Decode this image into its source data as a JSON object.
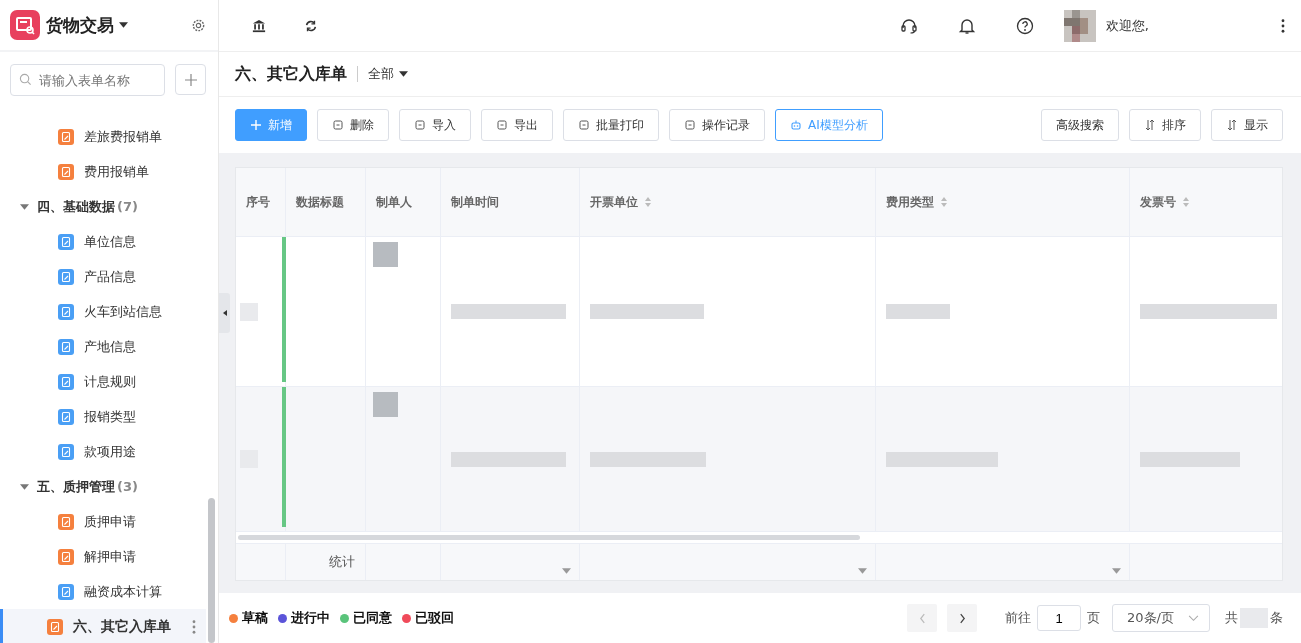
{
  "sidebar": {
    "app_title": "货物交易",
    "search": {
      "placeholder": "请输入表单名称"
    },
    "tree": [
      {
        "kind": "item",
        "label": "差旅费报销单",
        "color": "#f5803e",
        "selected": false
      },
      {
        "kind": "item",
        "label": "费用报销单",
        "color": "#f5803e",
        "selected": false
      },
      {
        "kind": "group",
        "label": "四、基础数据",
        "count": "(7)",
        "expanded": true,
        "children": [
          {
            "kind": "item",
            "label": "单位信息",
            "color": "#4a9ff5",
            "selected": false
          },
          {
            "kind": "item",
            "label": "产品信息",
            "color": "#4a9ff5",
            "selected": false
          },
          {
            "kind": "item",
            "label": "火车到站信息",
            "color": "#4a9ff5",
            "selected": false
          },
          {
            "kind": "item",
            "label": "产地信息",
            "color": "#4a9ff5",
            "selected": false
          },
          {
            "kind": "item",
            "label": "计息规则",
            "color": "#4a9ff5",
            "selected": false
          },
          {
            "kind": "item",
            "label": "报销类型",
            "color": "#4a9ff5",
            "selected": false
          },
          {
            "kind": "item",
            "label": "款项用途",
            "color": "#4a9ff5",
            "selected": false
          }
        ]
      },
      {
        "kind": "group",
        "label": "五、质押管理",
        "count": "(3)",
        "expanded": true,
        "children": [
          {
            "kind": "item",
            "label": "质押申请",
            "color": "#f5803e",
            "selected": false
          },
          {
            "kind": "item",
            "label": "解押申请",
            "color": "#f5803e",
            "selected": false
          },
          {
            "kind": "item",
            "label": "融资成本计算",
            "color": "#4a9ff5",
            "selected": false
          }
        ]
      },
      {
        "kind": "item",
        "label": "六、其它入库单",
        "color": "#f5803e",
        "selected": true
      }
    ]
  },
  "header": {
    "greeting": "欢迎您,"
  },
  "page": {
    "title": "六、其它入库单",
    "filter": "全部"
  },
  "toolbar": {
    "left": [
      {
        "label": "新增",
        "kind": "primary"
      },
      {
        "label": "删除",
        "kind": "plain"
      },
      {
        "label": "导入",
        "kind": "plain"
      },
      {
        "label": "导出",
        "kind": "plain"
      },
      {
        "label": "批量打印",
        "kind": "plain"
      },
      {
        "label": "操作记录",
        "kind": "plain"
      },
      {
        "label": "AI模型分析",
        "kind": "outline"
      }
    ],
    "right": [
      {
        "label": "高级搜索",
        "kind": "plain"
      },
      {
        "label": "排序",
        "kind": "icon"
      },
      {
        "label": "显示",
        "kind": "icon"
      }
    ]
  },
  "table": {
    "columns": [
      {
        "label": "序号",
        "sortable": false
      },
      {
        "label": "数据标题",
        "sortable": false
      },
      {
        "label": "制单人",
        "sortable": false
      },
      {
        "label": "制单时间",
        "sortable": false
      },
      {
        "label": "开票单位",
        "sortable": true
      },
      {
        "label": "费用类型",
        "sortable": true
      },
      {
        "label": "发票号",
        "sortable": true
      }
    ],
    "rows": [
      {
        "selected": false,
        "color": "#67c785"
      },
      {
        "selected": true,
        "color": "#67c785"
      }
    ],
    "summary": {
      "label": "统计"
    }
  },
  "legend": [
    {
      "label": "草稿",
      "color": "#f5803e"
    },
    {
      "label": "进行中",
      "color": "#5b54d9"
    },
    {
      "label": "已同意",
      "color": "#5ac47b"
    },
    {
      "label": "已驳回",
      "color": "#f04a5a"
    }
  ],
  "pagination": {
    "goto": "前往",
    "page": "1",
    "page_unit": "页",
    "page_size": "20条/页",
    "total_prefix": "共",
    "total_suffix": "条"
  }
}
